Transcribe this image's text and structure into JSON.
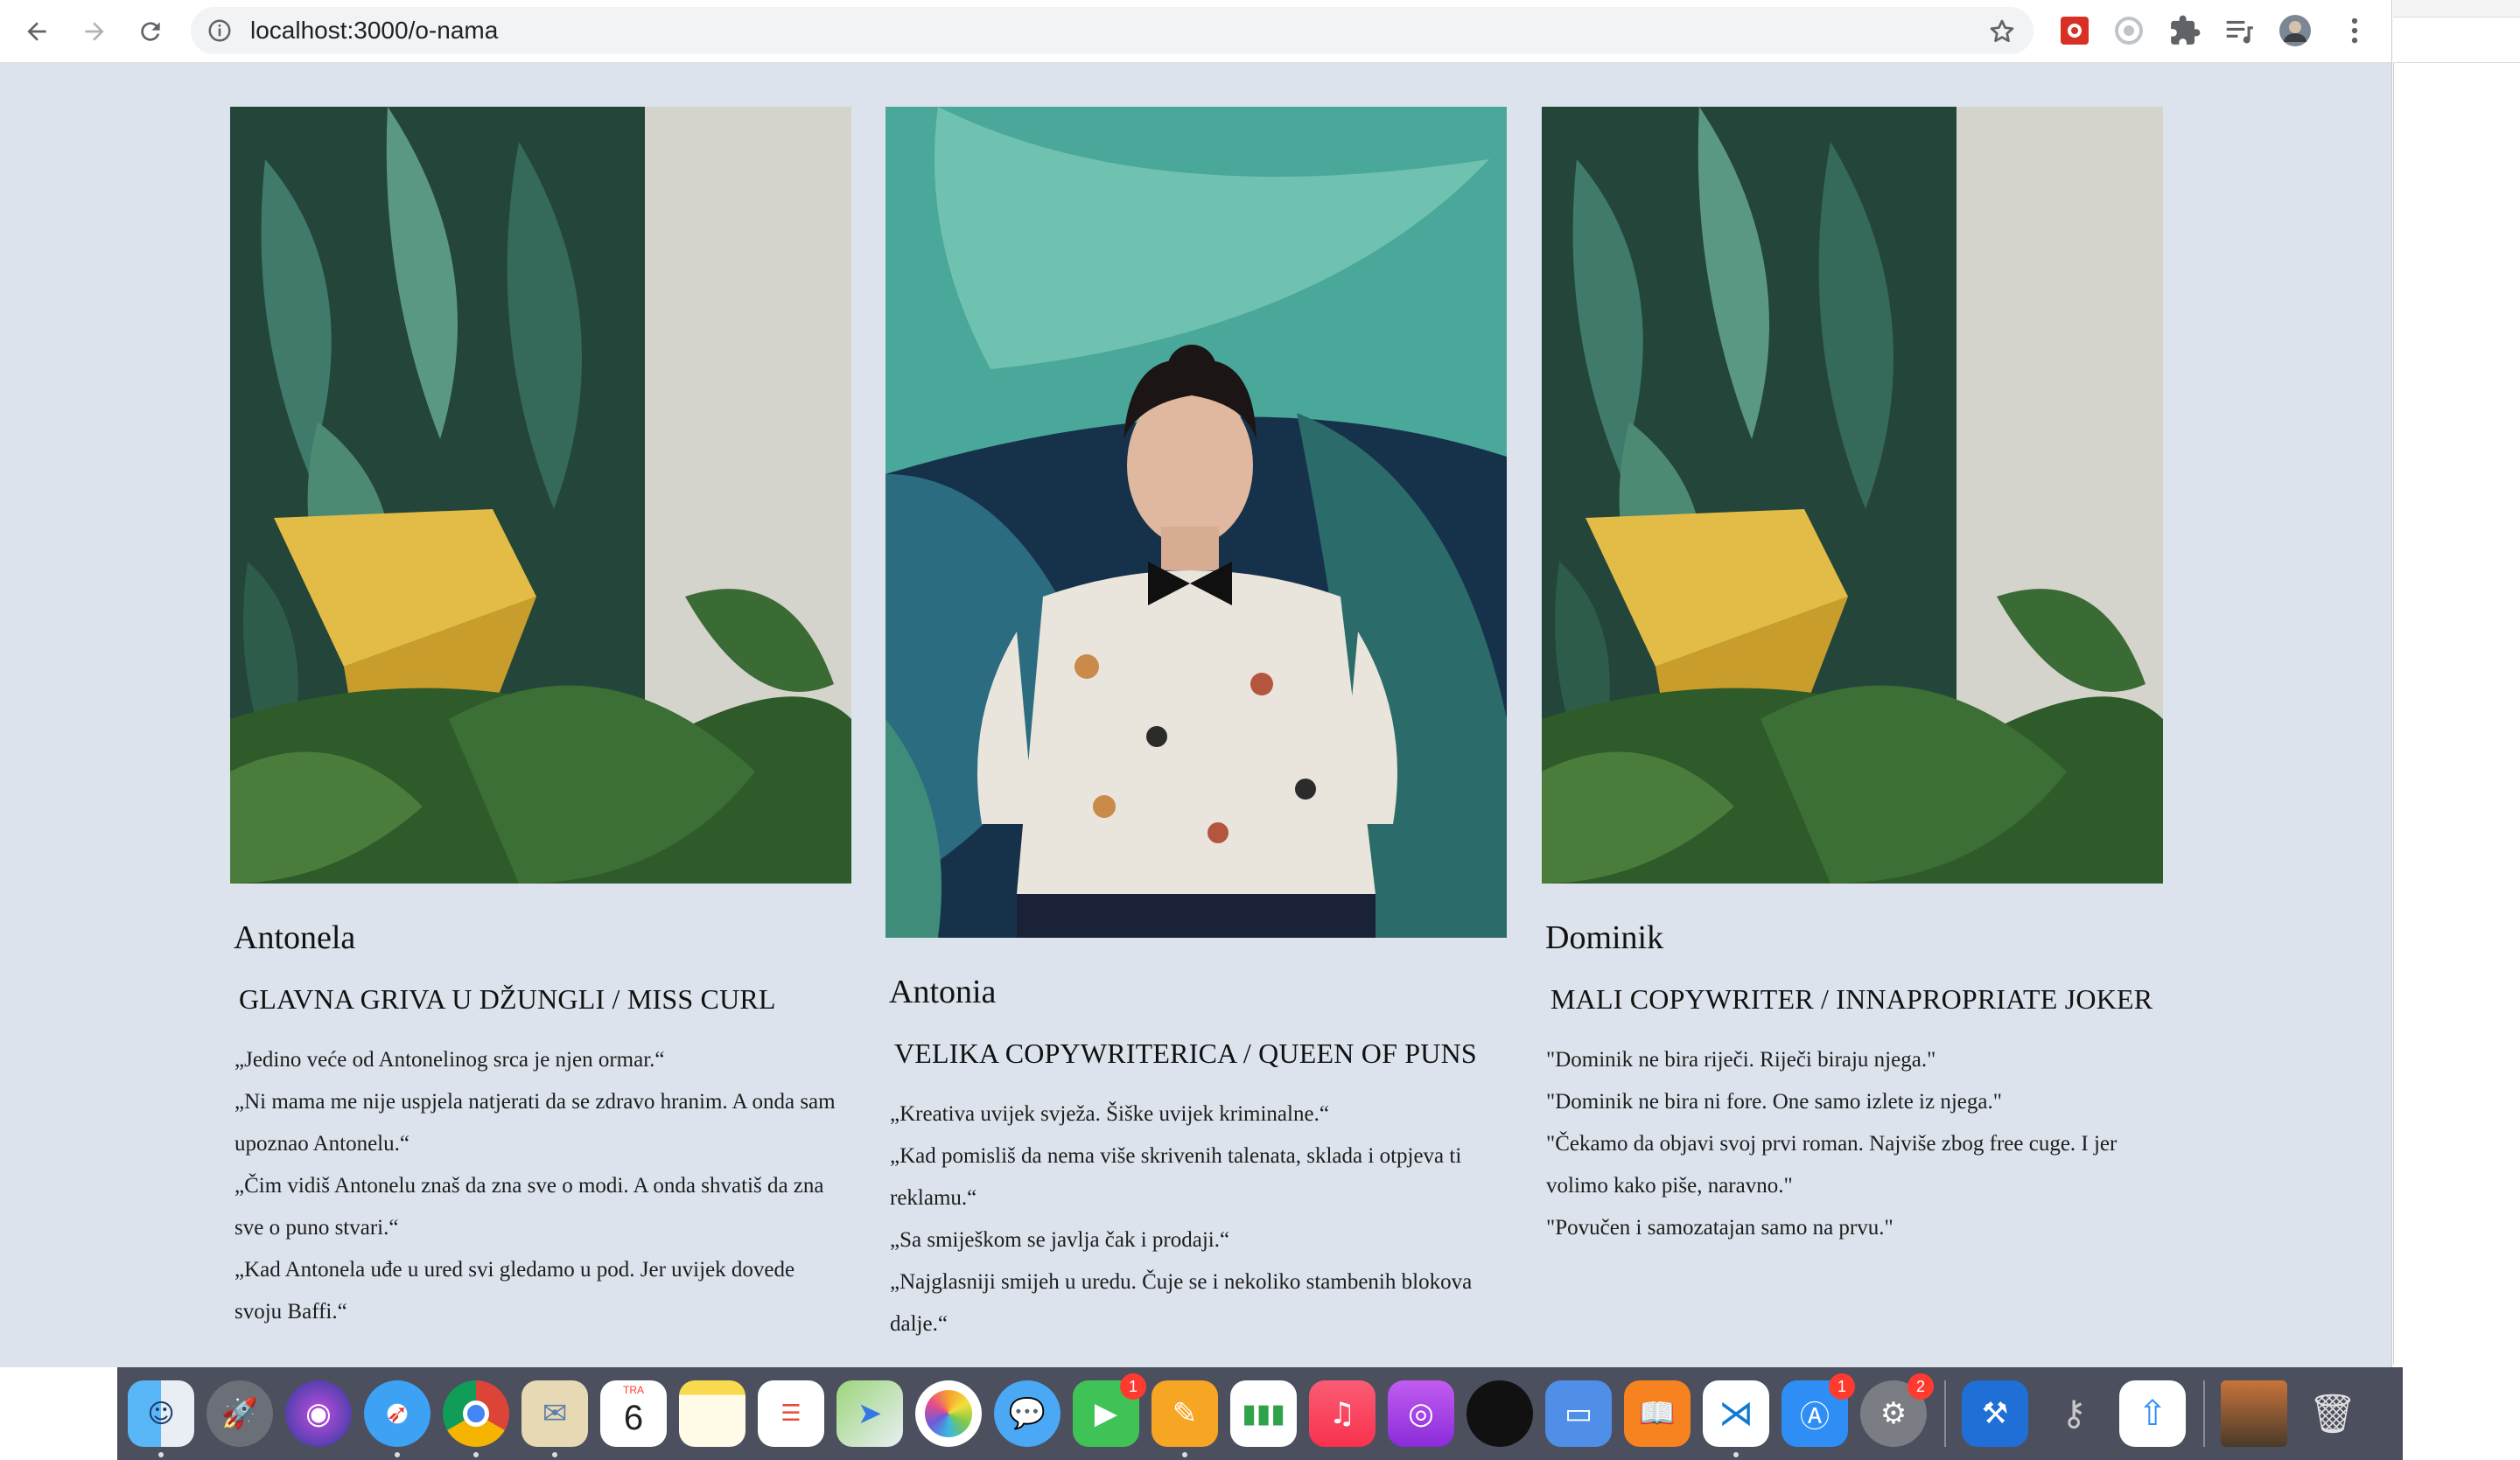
{
  "browser": {
    "url": "localhost:3000/o-nama",
    "icons": [
      "back-arrow-icon",
      "forward-arrow-icon",
      "reload-icon",
      "info-icon",
      "bookmark-star-icon",
      "extension-icon",
      "reading-list-icon",
      "profile-avatar-icon",
      "more-vert-icon"
    ]
  },
  "team": [
    {
      "name": "Antonela",
      "role": "GLAVNA GRIVA U DŽUNGLI / MISS CURL",
      "quotes": [
        "„Jedino veće od Antonelinog srca je njen ormar.“",
        "„Ni mama me nije uspjela natjerati da se zdravo hranim. A onda sam upoznao Antonelu.“",
        "„Čim vidiš Antonelu znaš da zna sve o modi. A onda shvatiš da zna sve o puno stvari.“",
        "„Kad Antonela uđe u ured svi gledamo u pod. Jer uvijek dovede svoju Baffi.“"
      ]
    },
    {
      "name": "Antonia",
      "role": "VELIKA COPYWRITERICA / QUEEN OF PUNS",
      "quotes": [
        "„Kreativa uvijek svježa. Šiške uvijek kriminalne.“",
        "„Kad pomisliš da nema više skrivenih talenata, sklada i otpjeva ti reklamu.“",
        "„Sa smiješkom se javlja čak i prodaji.“",
        "„Najglasniji smijeh u uredu. Čuje se i nekoliko stambenih blokova dalje.“"
      ]
    },
    {
      "name": "Dominik",
      "role": "MALI COPYWRITER / INNAPROPRIATE JOKER",
      "quotes": [
        "\"Dominik ne bira riječi. Riječi biraju njega.\"",
        "\"Dominik ne bira ni fore. One samo izlete iz njega.\"",
        "\"Čekamo da objavi svoj prvi roman. Najviše zbog free cuge. I jer volimo kako piše, naravno.\"",
        "\"Povučen i samozatajan samo na prvu.\""
      ]
    }
  ],
  "dock": {
    "calendar_month": "TRA",
    "calendar_day": "6",
    "facetime_badge": "1",
    "appstore_badge": "1",
    "settings_badge": "2",
    "apps": [
      "finder-icon",
      "launchpad-icon",
      "siri-icon",
      "safari-icon",
      "chrome-icon",
      "mail-icon",
      "calendar-icon",
      "notes-icon",
      "reminders-icon",
      "maps-icon",
      "photos-icon",
      "messages-icon",
      "facetime-icon",
      "pages-icon",
      "numbers-icon",
      "music-icon",
      "podcasts-icon",
      "tv-icon",
      "keynote-icon",
      "books-icon",
      "vscode-icon",
      "appstore-icon",
      "system-preferences-icon",
      "xcode-icon",
      "keychain-icon",
      "transmit-icon",
      "screenshot-preview-icon",
      "trash-icon"
    ]
  },
  "colors": {
    "page_bg": "#dde3ec",
    "toolbar_bg": "#ffffff",
    "omnibox_bg": "#f1f3f4",
    "dock_bg": "#3c4050"
  }
}
